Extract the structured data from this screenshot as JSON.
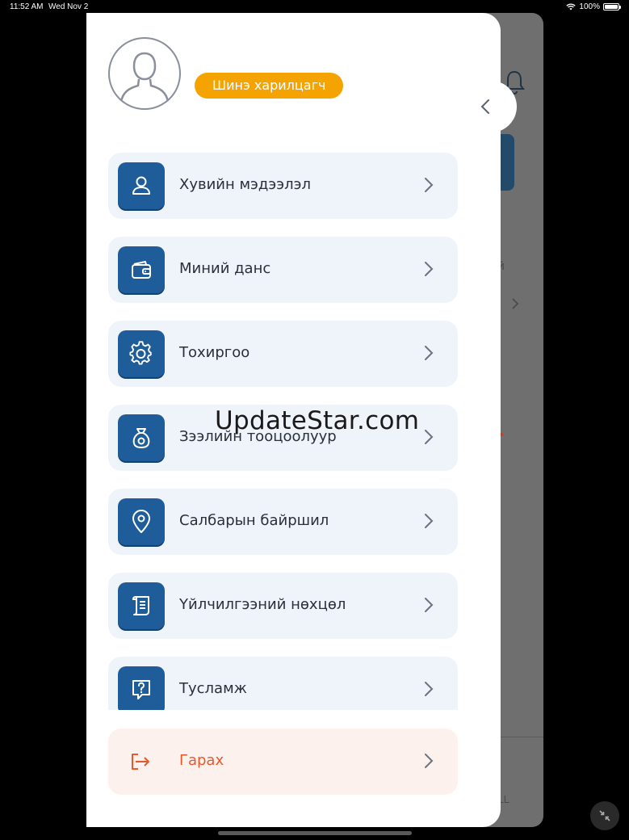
{
  "status_bar": {
    "time": "11:52 AM",
    "date": "Wed Nov 2",
    "battery": "100%"
  },
  "user": {
    "badge_label": "Шинэ харилцагч"
  },
  "menu": {
    "items": [
      {
        "label": "Хувийн мэдээлэл",
        "icon": "user-icon"
      },
      {
        "label": "Миний данс",
        "icon": "wallet-icon"
      },
      {
        "label": "Тохиргоо",
        "icon": "gear-icon"
      },
      {
        "label": "Зээлийн тооцоолуур",
        "icon": "money-bag-icon"
      },
      {
        "label": "Салбарын байршил",
        "icon": "location-pin-icon"
      },
      {
        "label": "Үйлчилгээний нөхцөл",
        "icon": "document-icon"
      },
      {
        "label": "Тусламж",
        "icon": "help-icon"
      }
    ],
    "logout_label": "Гарах"
  },
  "watermark": "UpdateStar.com",
  "background_app": {
    "bottom_text": "LL",
    "side_text": "й"
  },
  "colors": {
    "accent": "#1f5d9a",
    "badge": "#f5a300",
    "logout": "#e8582b",
    "item_bg": "#eff3fa"
  }
}
